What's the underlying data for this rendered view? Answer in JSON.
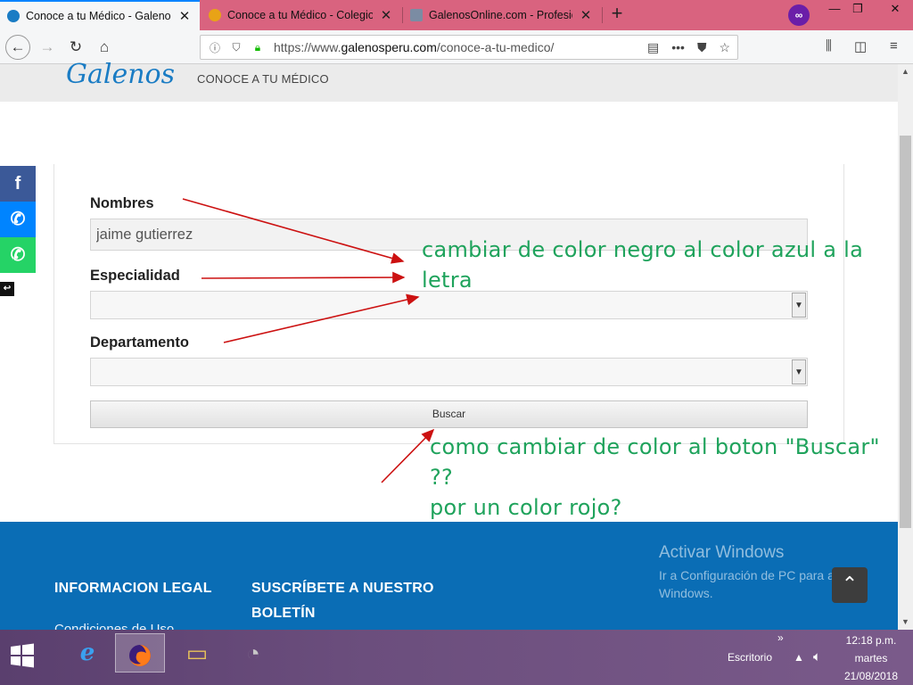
{
  "browser": {
    "tabs": [
      {
        "title": "Conoce a tu Médico - Galenos",
        "active": true,
        "favicon_color": "#1a7cc4"
      },
      {
        "title": "Conoce a tu Médico - Colegio M",
        "active": false,
        "favicon_color": "#e8a317"
      },
      {
        "title": "GalenosOnline.com - Profesion",
        "active": false,
        "favicon_color": "#7b8ca3"
      }
    ],
    "url": {
      "prefix": "https://www.",
      "host": "galenosperu.com",
      "path": "/conoce-a-tu-medico/"
    },
    "tabstrip_color": "#d9637f"
  },
  "site": {
    "logo": "Galenos",
    "subtitle": "CONOCE A TU MÉDICO"
  },
  "form": {
    "nombres_label": "Nombres",
    "nombres_value": "jaime gutierrez",
    "especialidad_label": "Especialidad",
    "especialidad_value": "",
    "departamento_label": "Departamento",
    "departamento_value": "",
    "buscar_label": "Buscar"
  },
  "annotations": {
    "note1_line1": "cambiar de color negro al color azul a la",
    "note1_line2": "letra",
    "note2_line1": "como cambiar de color al boton \"Buscar\"",
    "note2_line2": "??",
    "note2_line3": "por un color rojo?",
    "color": "#1fa35c",
    "arrow_color": "#cc1111"
  },
  "footer": {
    "col1": "INFORMACION LEGAL",
    "col2_line1": "SUSCRÍBETE A NUESTRO",
    "col2_line2": "BOLETÍN",
    "cut_text": "Condiciones de Uso",
    "activate_title": "Activar Windows",
    "activate_text": "Ir a Configuración de PC para activar Windows.",
    "color": "#0a6db5"
  },
  "taskbar": {
    "escritorio": "Escritorio",
    "time": "12:18 p.m.",
    "day": "martes",
    "date": "21/08/2018"
  }
}
